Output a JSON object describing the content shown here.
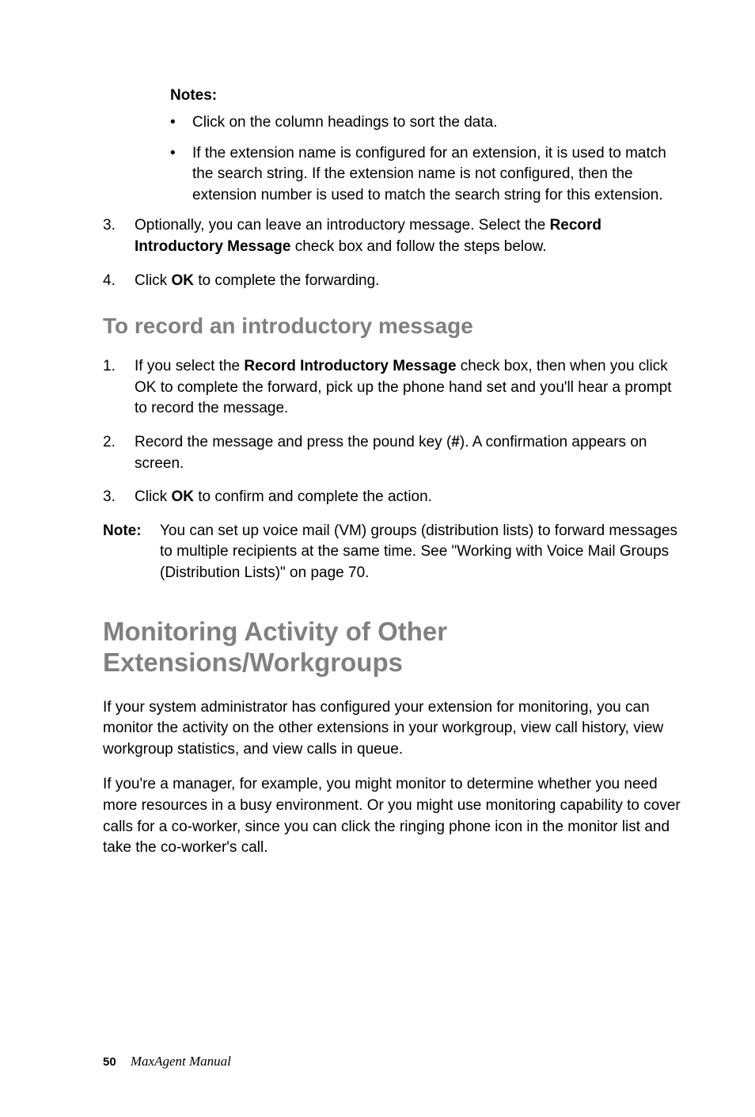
{
  "notes_label": "Notes",
  "bullet1": "Click on the column headings to sort the data.",
  "bullet2": "If the extension name is configured for an extension, it is used to match the search string. If the extension name is not configured, then the extension number is used to match the search string for this extension.",
  "step3_prefix": "Optionally, you can leave an introductory message. Select the ",
  "step3_bold": "Record Introductory Message",
  "step3_suffix": " check box and follow the steps below.",
  "step4_prefix": "Click ",
  "step4_bold": "OK",
  "step4_suffix": " to complete the forwarding.",
  "heading_record": "To record an introductory message",
  "rec1_prefix": "If you select the ",
  "rec1_bold": "Record Introductory Message",
  "rec1_suffix": " check box, then when you click OK to complete the forward, pick up the phone hand set and you'll hear a prompt to record the message.",
  "rec2_prefix": "Record the message and press the pound key (",
  "rec2_bold": "#",
  "rec2_suffix": "). A confirmation appears on screen.",
  "rec3_prefix": "Click ",
  "rec3_bold": "OK",
  "rec3_suffix": " to confirm and complete the action.",
  "note_label": "Note:",
  "note_text": "You can set up voice mail (VM) groups (distribution lists) to forward messages to multiple recipients at the same time. See \"Working with Voice Mail Groups (Distribution Lists)\" on page 70.",
  "heading_monitor": "Monitoring Activity of Other Extensions/Workgroups",
  "para1": "If your system administrator has configured your extension for monitoring, you can monitor the activity on the other extensions in your workgroup, view call history, view workgroup statistics, and view calls in queue.",
  "para2": "If you're a manager, for example, you might monitor to determine whether you need more resources in a busy environment. Or you might use monitoring capability to cover calls for a co-worker, since you can click the ringing phone icon in the monitor list and take the co-worker's call.",
  "footer_page": "50",
  "footer_title": "MaxAgent Manual",
  "markers": {
    "n3": "3.",
    "n4": "4.",
    "n1": "1.",
    "n2": "2.",
    "dot": "•",
    "colon": ":"
  }
}
